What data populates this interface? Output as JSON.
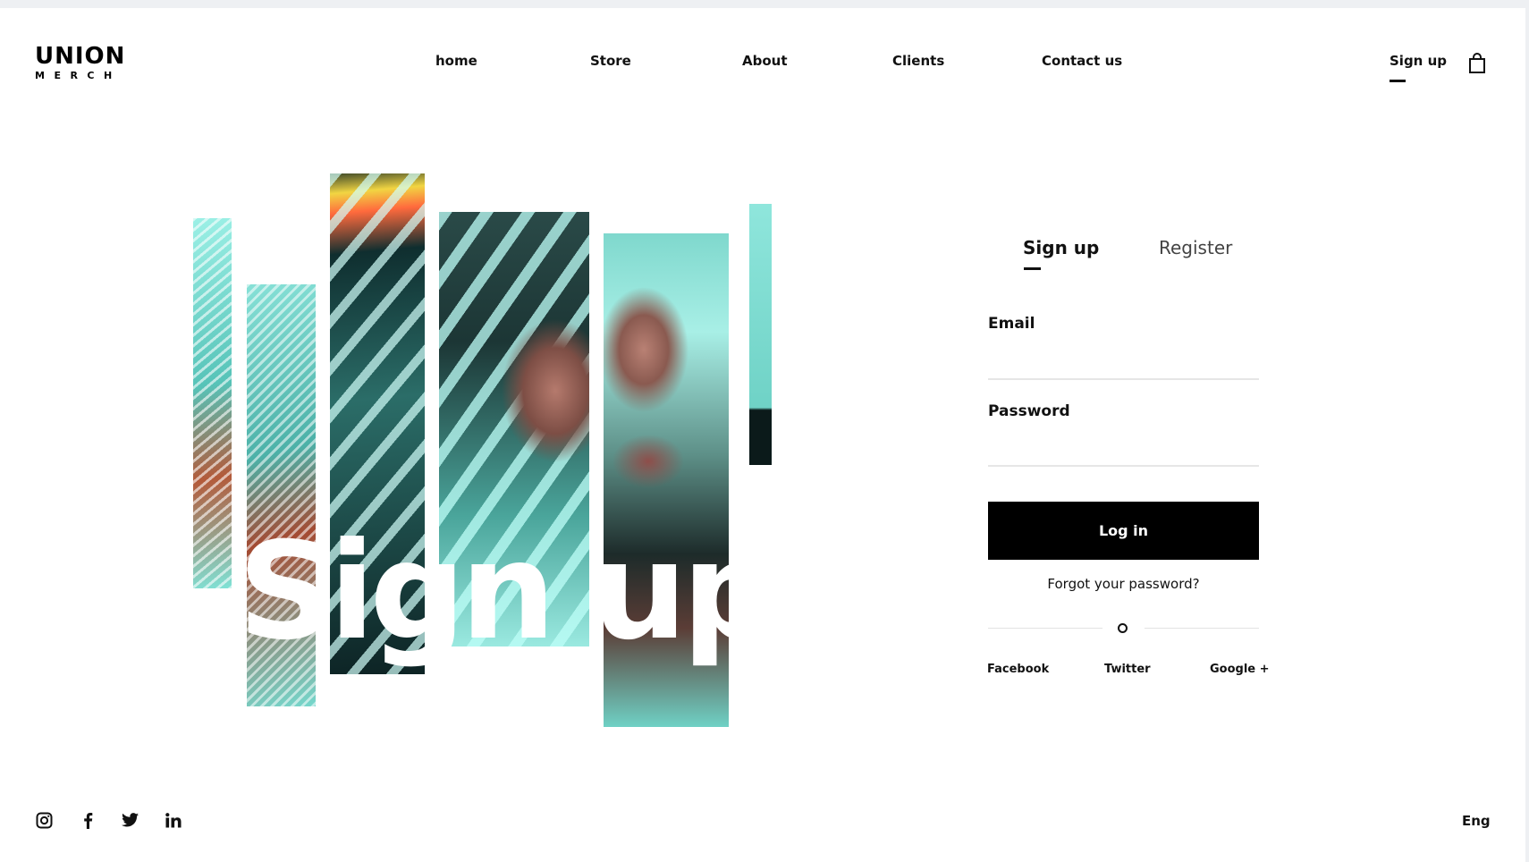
{
  "brand": {
    "name": "UNION",
    "sub": "MERCH"
  },
  "nav": {
    "items": [
      {
        "label": "home"
      },
      {
        "label": "Store"
      },
      {
        "label": "About"
      },
      {
        "label": "Clients"
      },
      {
        "label": "Contact us"
      }
    ],
    "signup_label": "Sign up",
    "cart_icon": "shopping-bag-icon"
  },
  "hero": {
    "title": "Sign up"
  },
  "auth": {
    "tabs": [
      {
        "label": "Sign up",
        "active": true
      },
      {
        "label": "Register",
        "active": false
      }
    ],
    "email_label": "Email",
    "email_value": "",
    "password_label": "Password",
    "password_value": "",
    "login_label": "Log in",
    "forgot_label": "Forgot your password?",
    "social": [
      {
        "label": "Facebook"
      },
      {
        "label": "Twitter"
      },
      {
        "label": "Google +"
      }
    ]
  },
  "footer": {
    "icons": [
      "instagram-icon",
      "facebook-icon",
      "twitter-icon",
      "linkedin-icon"
    ],
    "language": "Eng"
  },
  "colors": {
    "accent": "#000000",
    "background": "#ffffff",
    "teal": "#7fe3d7"
  }
}
